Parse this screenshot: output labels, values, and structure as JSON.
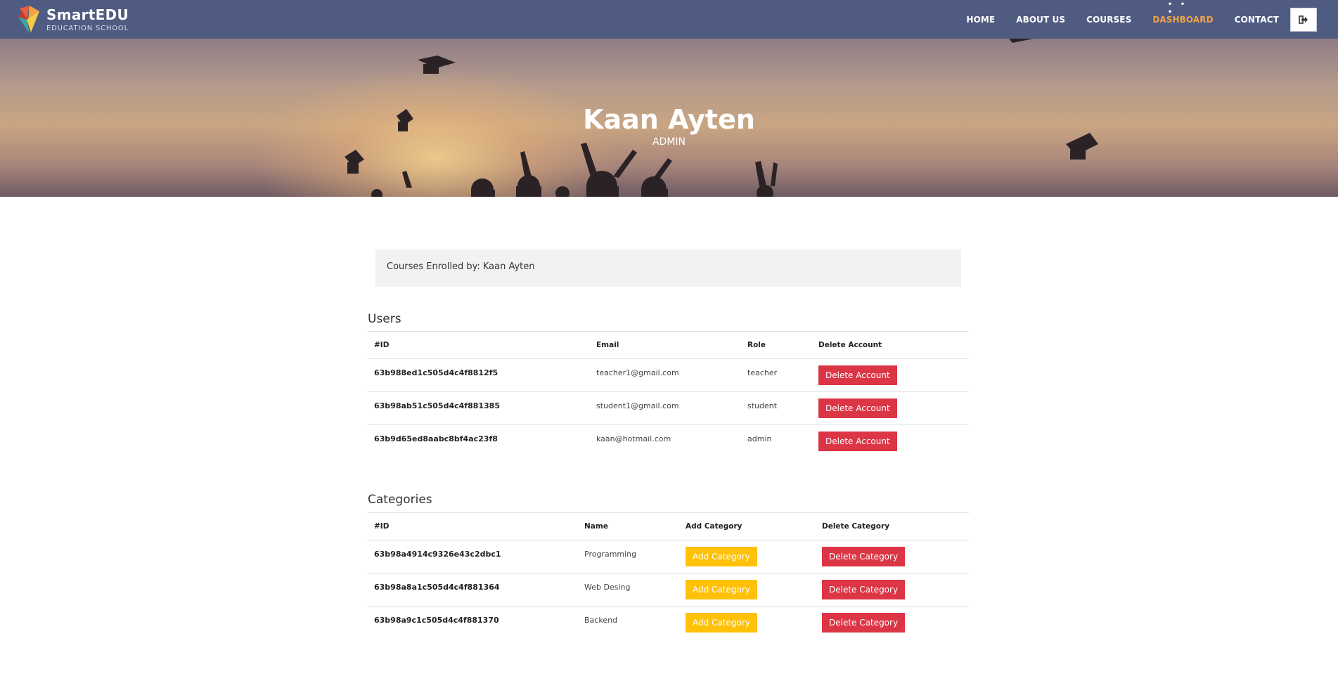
{
  "brand": {
    "name": "SmartEDU",
    "tagline": "EDUCATION SCHOOL"
  },
  "nav": {
    "items": [
      {
        "label": "HOME",
        "active": false
      },
      {
        "label": "ABOUT US",
        "active": false
      },
      {
        "label": "COURSES",
        "active": false
      },
      {
        "label": "DASHBOARD",
        "active": true
      },
      {
        "label": "CONTACT",
        "active": false
      }
    ],
    "active_dots": "• • •",
    "logout_icon": "sign-out-icon"
  },
  "hero": {
    "name": "Kaan Ayten",
    "role": "ADMIN"
  },
  "enrolled": {
    "text": "Courses Enrolled by: Kaan Ayten"
  },
  "users": {
    "title": "Users",
    "headers": {
      "id": "#ID",
      "email": "Email",
      "role": "Role",
      "delete": "Delete Account"
    },
    "rows": [
      {
        "id": "63b988ed1c505d4c4f8812f5",
        "email": "teacher1@gmail.com",
        "role": "teacher",
        "delete_label": "Delete Account"
      },
      {
        "id": "63b98ab51c505d4c4f881385",
        "email": "student1@gmail.com",
        "role": "student",
        "delete_label": "Delete Account"
      },
      {
        "id": "63b9d65ed8aabc8bf4ac23f8",
        "email": "kaan@hotmail.com",
        "role": "admin",
        "delete_label": "Delete Account"
      }
    ]
  },
  "categories": {
    "title": "Categories",
    "headers": {
      "id": "#ID",
      "name": "Name",
      "add": "Add Category",
      "delete": "Delete Category"
    },
    "rows": [
      {
        "id": "63b98a4914c9326e43c2dbc1",
        "name": "Programming",
        "add_label": "Add Category",
        "delete_label": "Delete Category"
      },
      {
        "id": "63b98a8a1c505d4c4f881364",
        "name": "Web Desing",
        "add_label": "Add Category",
        "delete_label": "Delete Category"
      },
      {
        "id": "63b98a9c1c505d4c4f881370",
        "name": "Backend",
        "add_label": "Add Category",
        "delete_label": "Delete Category"
      }
    ]
  },
  "colors": {
    "navbar": "#4f5b81",
    "active_nav": "#f2a34a",
    "danger": "#dc3545",
    "warning": "#ffc107"
  }
}
